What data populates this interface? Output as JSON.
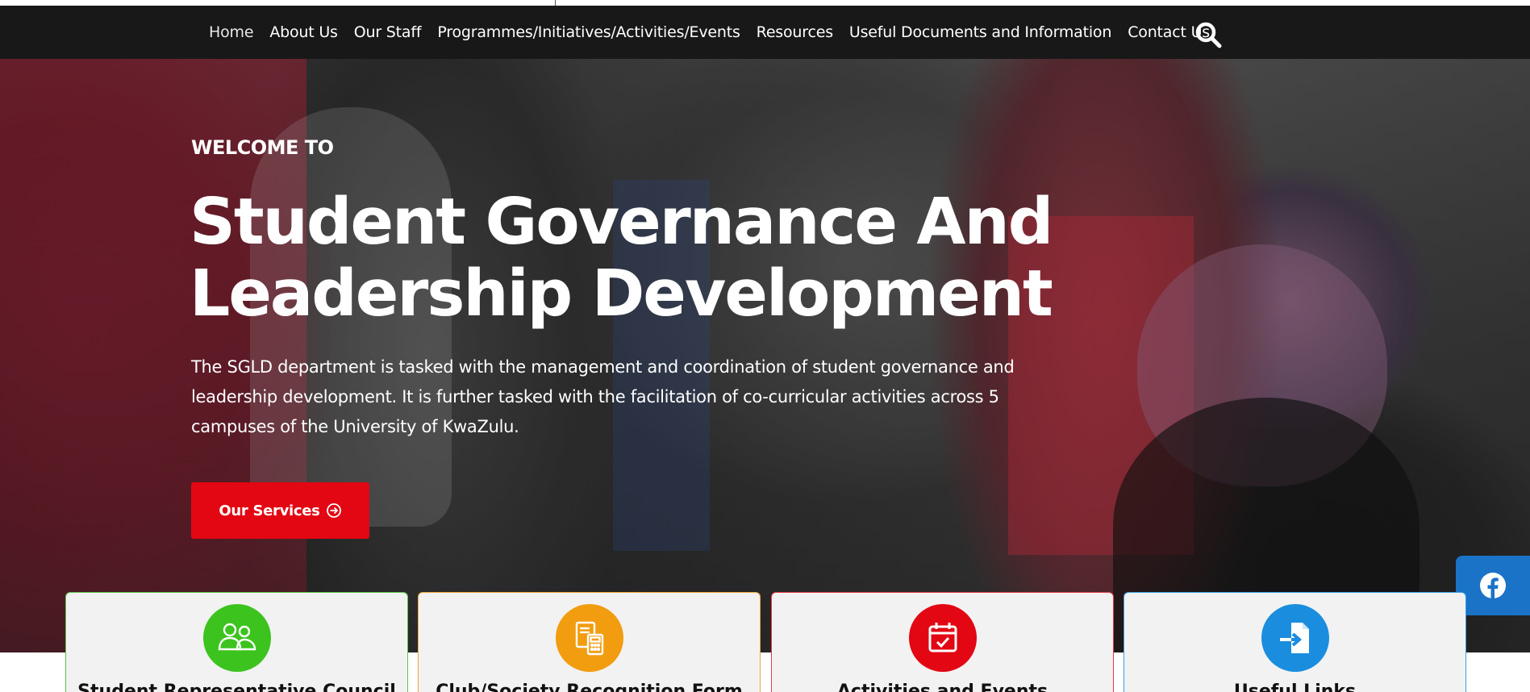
{
  "nav": {
    "items": [
      {
        "label": "Home",
        "active": true
      },
      {
        "label": "About Us"
      },
      {
        "label": "Our Staff"
      },
      {
        "label": "Programmes/Initiatives/Activities/Events"
      },
      {
        "label": "Resources"
      },
      {
        "label": "Useful Documents and Information"
      },
      {
        "label": "Contact Us"
      }
    ],
    "search_icon": "search-icon"
  },
  "hero": {
    "kicker": "WELCOME TO",
    "title_line1": "Student Governance And",
    "title_line2": "Leadership Development",
    "description": "The SGLD department is tasked with the management and coordination of student governance and leadership development. It is further tasked with the facilitation of co-curricular activities across 5 campuses of the University of KwaZulu.",
    "cta_label": "Our Services",
    "cta_icon": "arrow-circle-right-icon"
  },
  "social": {
    "facebook_icon": "facebook-icon"
  },
  "cards": [
    {
      "title": "Student Representative Council",
      "icon": "people-icon",
      "color": "#3cc31e",
      "border": "#5cc24a"
    },
    {
      "title": "Club/Society Recognition Form",
      "icon": "calculator-document-icon",
      "color": "#f29c0f",
      "border": "#f0a63a"
    },
    {
      "title": "Activities and Events",
      "icon": "calendar-check-icon",
      "color": "#e30613",
      "border": "#e53b45"
    },
    {
      "title": "Useful Links",
      "icon": "file-import-icon",
      "color": "#1a8ddf",
      "border": "#3aa0e6"
    }
  ],
  "colors": {
    "navbar": "#181818",
    "accent_red": "#e30613",
    "facebook_blue": "#1a73c7"
  }
}
